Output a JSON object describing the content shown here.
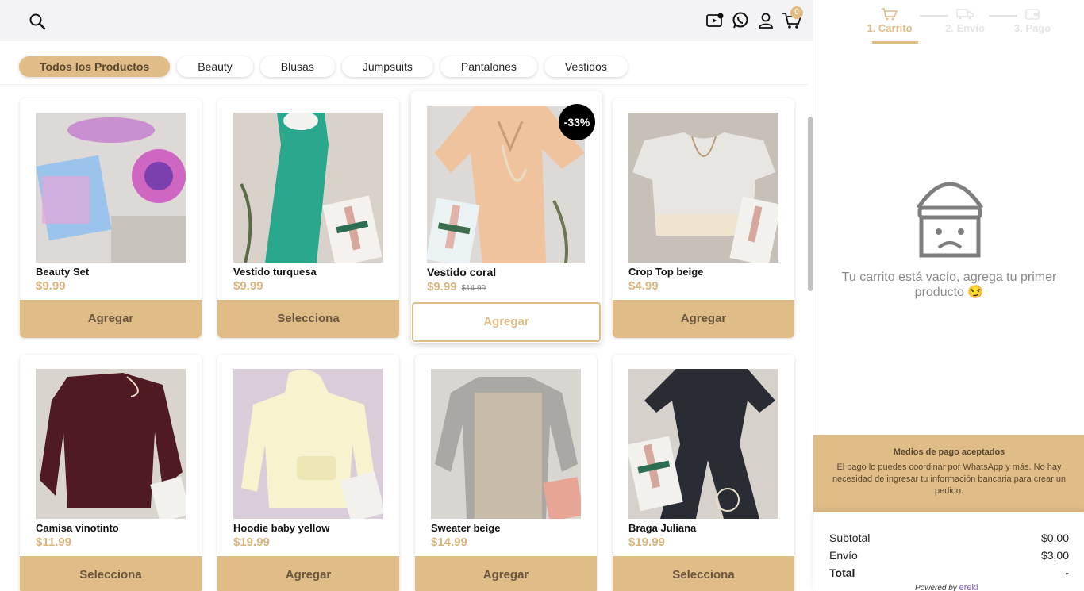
{
  "header": {
    "cart_count": "0"
  },
  "categories": [
    "Todos los Productos",
    "Beauty",
    "Blusas",
    "Jumpsuits",
    "Pantalones",
    "Vestidos"
  ],
  "products": [
    {
      "name": "Beauty Set",
      "price": "$9.99",
      "old_price": "",
      "button": "Agregar",
      "discount": "",
      "img": "beauty"
    },
    {
      "name": "Vestido turquesa",
      "price": "$9.99",
      "old_price": "",
      "button": "Selecciona",
      "discount": "",
      "img": "turq"
    },
    {
      "name": "Vestido coral",
      "price": "$9.99",
      "old_price": "$14.99",
      "button": "Agregar",
      "discount": "-33%",
      "img": "coral"
    },
    {
      "name": "Crop Top beige",
      "price": "$4.99",
      "old_price": "",
      "button": "Agregar",
      "discount": "",
      "img": "crop"
    },
    {
      "name": "Camisa vinotinto",
      "price": "$11.99",
      "old_price": "",
      "button": "Selecciona",
      "discount": "",
      "img": "camisa"
    },
    {
      "name": "Hoodie baby yellow",
      "price": "$19.99",
      "old_price": "",
      "button": "Agregar",
      "discount": "",
      "img": "hoodie"
    },
    {
      "name": "Sweater beige",
      "price": "$14.99",
      "old_price": "",
      "button": "Agregar",
      "discount": "",
      "img": "sweater"
    },
    {
      "name": "Braga Juliana",
      "price": "$19.99",
      "old_price": "",
      "button": "Selecciona",
      "discount": "",
      "img": "braga"
    }
  ],
  "sidebar": {
    "steps": [
      "1. Carrito",
      "2. Envío",
      "3. Pago"
    ],
    "empty_text": "Tu carrito está vacío, agrega tu primer producto 😏",
    "payment_title": "Medios de pago aceptados",
    "payment_desc": "El pago lo puedes coordinar por WhatsApp y más. No hay necesidad de ingresar tu información bancaria para crear un pedido.",
    "subtotal_label": "Subtotal",
    "subtotal": "$0.00",
    "shipping_label": "Envío",
    "shipping": "$3.00",
    "total_label": "Total",
    "total": "-",
    "powered_by": "Powered by",
    "brand": "ereki"
  },
  "colors": {
    "accent": "#e0bc87",
    "accent_text": "#d8b57f"
  }
}
